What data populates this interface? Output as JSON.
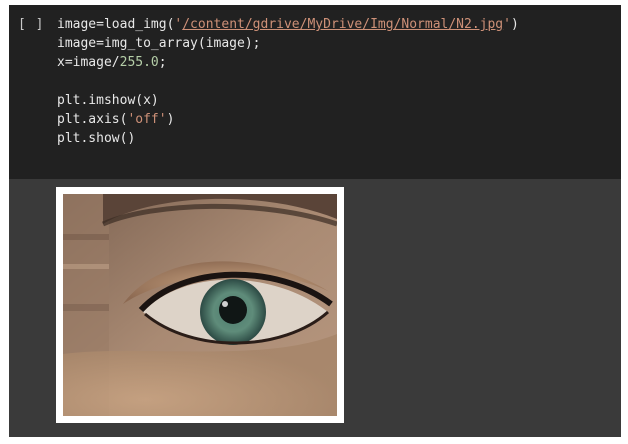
{
  "cell": {
    "run_button_label": "[ ]",
    "code_lines": [
      {
        "parts": [
          {
            "t": "image=load_img(",
            "c": ""
          },
          {
            "t": "'",
            "c": "str"
          },
          {
            "t": "/content/gdrive/MyDrive/Img/Normal/N2.jpg",
            "c": "str link"
          },
          {
            "t": "'",
            "c": "str"
          },
          {
            "t": ")",
            "c": ""
          }
        ]
      },
      {
        "parts": [
          {
            "t": "image=img_to_array(image);",
            "c": ""
          }
        ]
      },
      {
        "parts": [
          {
            "t": "x=image/",
            "c": ""
          },
          {
            "t": "255.0",
            "c": "num"
          },
          {
            "t": ";",
            "c": ""
          }
        ]
      },
      {
        "parts": [
          {
            "t": "",
            "c": ""
          }
        ]
      },
      {
        "parts": [
          {
            "t": "plt.imshow(x)",
            "c": ""
          }
        ]
      },
      {
        "parts": [
          {
            "t": "plt.axis(",
            "c": ""
          },
          {
            "t": "'off'",
            "c": "str"
          },
          {
            "t": ")",
            "c": ""
          }
        ]
      },
      {
        "parts": [
          {
            "t": "plt.show()",
            "c": ""
          }
        ]
      }
    ]
  },
  "output": {
    "image_subject": "eye-image"
  },
  "colors": {
    "code_bg": "#212121",
    "output_bg": "#3a3a3a",
    "string": "#ce9178",
    "number": "#b5cea8"
  }
}
